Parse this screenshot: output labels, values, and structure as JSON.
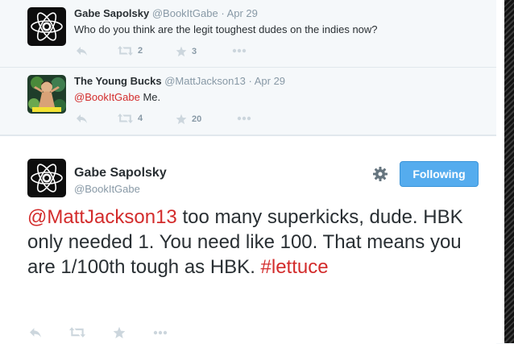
{
  "tweets": [
    {
      "name": "Gabe Sapolsky",
      "handle": "@BookItGabe",
      "separator": "·",
      "time": "Apr 29",
      "text": "Who do you think are the legit toughest dudes on the indies now?",
      "retweets": "2",
      "favorites": "3"
    },
    {
      "name": "The Young Bucks",
      "handle": "@MattJackson13",
      "separator": "·",
      "time": "Apr 29",
      "mention": "@BookItGabe",
      "text": " Me.",
      "retweets": "4",
      "favorites": "20",
      "avatar_caption": "MATT JACKSON"
    }
  ],
  "main": {
    "name": "Gabe Sapolsky",
    "handle": "@BookItGabe",
    "follow_label": "Following",
    "mention": "@MattJackson13",
    "text": " too many superkicks, dude. HBK only needed 1. You need like 100. That means you are 1/100th tough as HBK. ",
    "hashtag": "#lettuce"
  },
  "icons": {
    "reply": "reply-icon",
    "retweet": "retweet-icon",
    "favorite": "star-icon",
    "more": "more-icon",
    "settings": "gear-icon"
  },
  "colors": {
    "mention": "#d32c2c",
    "follow_button": "#55acee",
    "meta": "#8899a6",
    "action_icon": "#ccd6dd"
  }
}
